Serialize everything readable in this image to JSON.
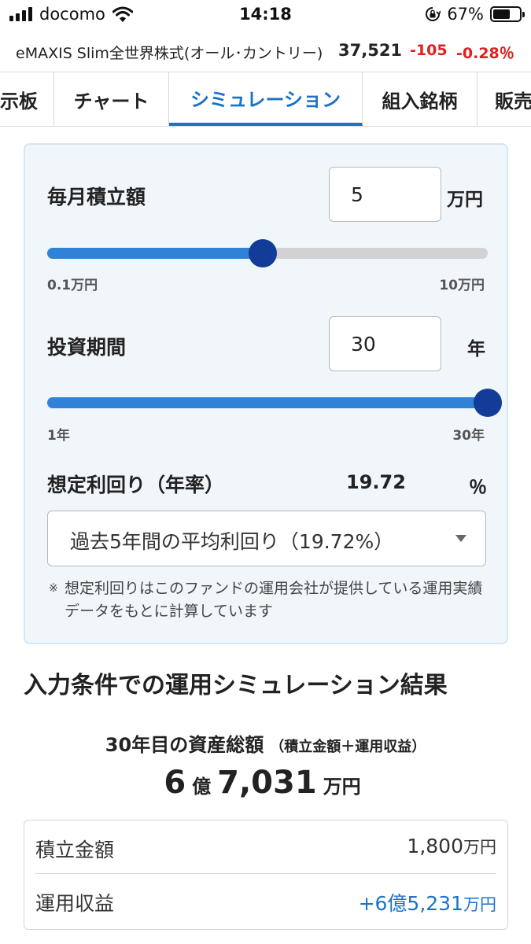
{
  "status_bar": {
    "carrier": "docomo",
    "time": "14:18",
    "battery_percent": "67%",
    "battery_level": 0.67,
    "icons": [
      "signal-icon",
      "wifi-icon",
      "rotation-lock-icon",
      "battery-icon"
    ]
  },
  "fund": {
    "name": "eMAXIS Slim全世界株式(オール･カントリー)",
    "price": "37,521",
    "change": "-105",
    "change_percent": "-0.28％"
  },
  "tabs": [
    {
      "label": "掲示板"
    },
    {
      "label": "チャート"
    },
    {
      "label": "シミュレーション",
      "active": true
    },
    {
      "label": "組入銘柄"
    },
    {
      "label": "販売会社"
    }
  ],
  "simulation": {
    "monthly": {
      "label": "毎月積立額",
      "value": "5",
      "unit": "万円",
      "min_label": "0.1万円",
      "max_label": "10万円",
      "slider_fraction": 0.49
    },
    "period": {
      "label": "投資期間",
      "value": "30",
      "unit": "年",
      "min_label": "1年",
      "max_label": "30年",
      "slider_fraction": 1.0
    },
    "rate": {
      "label": "想定利回り（年率）",
      "value": "19.72",
      "unit": "％",
      "select_value": "過去5年間の平均利回り（19.72%）"
    },
    "note_mark": "※",
    "note": "想定利回りはこのファンドの運用会社が提供している運用実績データをもとに計算しています"
  },
  "results": {
    "title": "入力条件での運用シミュレーション結果",
    "total_label": "30年目の資産総額",
    "total_label_sub": "（積立金額＋運用収益）",
    "total_oku": "6",
    "total_oku_unit": "億",
    "total_man": "7,031",
    "total_man_unit": "万円",
    "rows": [
      {
        "label": "積立金額",
        "value": "1,800",
        "unit": "万円"
      },
      {
        "label": "運用収益",
        "value": "+6億5,231",
        "unit": "万円"
      }
    ]
  },
  "colors": {
    "accent": "#1a73c8",
    "slider_fill": "#2f82d6",
    "slider_knob": "#123c97",
    "negative": "#e02020",
    "panel_bg": "#f1f6fb"
  }
}
